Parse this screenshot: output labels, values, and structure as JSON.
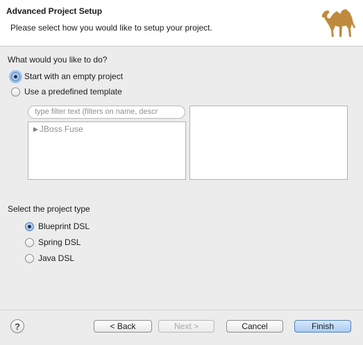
{
  "header": {
    "title": "Advanced Project Setup",
    "description": "Please select how you would like to setup your project.",
    "logo_icon": "camel-logo-icon",
    "logo_color": "#c08a3e"
  },
  "setup_choice": {
    "label": "What would you like to do?",
    "options": [
      {
        "label": "Start with an empty project",
        "selected": true
      },
      {
        "label": "Use a predefined template",
        "selected": false
      }
    ]
  },
  "template": {
    "filter_placeholder": "type filter text (filters on name, descr",
    "tree_items": [
      {
        "label": "JBoss Fuse",
        "icon": "triangle-right-icon",
        "enabled": false
      }
    ]
  },
  "project_type": {
    "label": "Select the project type",
    "options": [
      {
        "label": "Blueprint DSL",
        "selected": true
      },
      {
        "label": "Spring DSL",
        "selected": false
      },
      {
        "label": "Java DSL",
        "selected": false
      }
    ]
  },
  "footer": {
    "help": "?",
    "back_label": "< Back",
    "next_label": "Next >",
    "cancel_label": "Cancel",
    "finish_label": "Finish"
  }
}
